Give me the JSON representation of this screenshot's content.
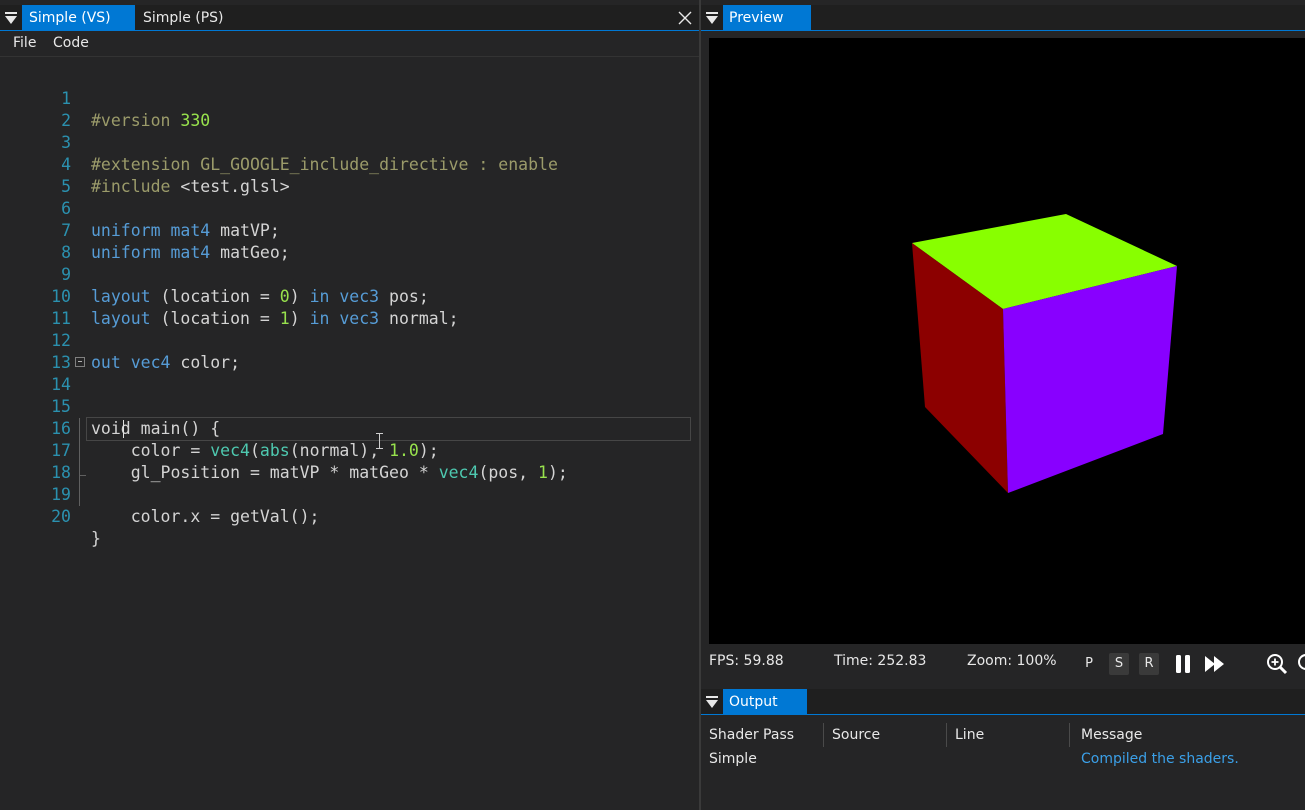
{
  "editor": {
    "tabs": [
      {
        "label": "Simple (VS)",
        "active": true
      },
      {
        "label": "Simple (PS)",
        "active": false
      }
    ],
    "menu": [
      "File",
      "Code"
    ],
    "lines": [
      {
        "n": "1"
      },
      {
        "n": "2"
      },
      {
        "n": "3"
      },
      {
        "n": "4"
      },
      {
        "n": "5"
      },
      {
        "n": "6"
      },
      {
        "n": "7"
      },
      {
        "n": "8"
      },
      {
        "n": "9"
      },
      {
        "n": "10"
      },
      {
        "n": "11"
      },
      {
        "n": "12"
      },
      {
        "n": "13"
      },
      {
        "n": "14"
      },
      {
        "n": "15"
      },
      {
        "n": "16"
      },
      {
        "n": "17"
      },
      {
        "n": "18"
      },
      {
        "n": "19"
      },
      {
        "n": "20"
      }
    ],
    "tokens": {
      "l1a": "#version ",
      "l1b": "330",
      "l3a": "#extension GL_GOOGLE_include_directive : enable",
      "l4a": "#include ",
      "l4b": "<test.glsl>",
      "l6a": "uniform",
      "l6b": " ",
      "l6c": "mat4",
      "l6d": " matVP;",
      "l7a": "uniform",
      "l7b": " ",
      "l7c": "mat4",
      "l7d": " matGeo;",
      "l9a": "layout",
      "l9b": " (location = ",
      "l9c": "0",
      "l9d": ") ",
      "l9e": "in",
      "l9f": " ",
      "l9g": "vec3",
      "l9h": " pos;",
      "l10a": "layout",
      "l10b": " (location = ",
      "l10c": "1",
      "l10d": ") ",
      "l10e": "in",
      "l10f": " ",
      "l10g": "vec3",
      "l10h": " normal;",
      "l12a": "out",
      "l12b": " ",
      "l12c": "vec4",
      "l12d": " color;",
      "l14a": "void main() {",
      "l15a": "    color = ",
      "l15b": "vec4",
      "l15c": "(",
      "l15d": "abs",
      "l15e": "(normal), ",
      "l15f": "1.0",
      "l15g": ");",
      "l16a": "    gl_Position = matVP * matGeo * ",
      "l16b": "vec4",
      "l16c": "(pos, ",
      "l16d": "1",
      "l16e": ");",
      "l18a": "    color.x = getVal();",
      "l19a": "}"
    }
  },
  "preview": {
    "title": "Preview",
    "fps": "FPS: 59.88",
    "time": "Time: 252.83",
    "zoom": "Zoom: 100%",
    "buttons": {
      "p": "P",
      "s": "S",
      "r": "R"
    },
    "cube_colors": {
      "top": "#88ff00",
      "left": "#8c0000",
      "right": "#8800ff"
    }
  },
  "output": {
    "title": "Output",
    "columns": [
      "Shader Pass",
      "Source",
      "Line",
      "Message"
    ],
    "rows": [
      {
        "pass": "Simple",
        "source": "",
        "line": "",
        "message": "Compiled the shaders."
      }
    ]
  }
}
